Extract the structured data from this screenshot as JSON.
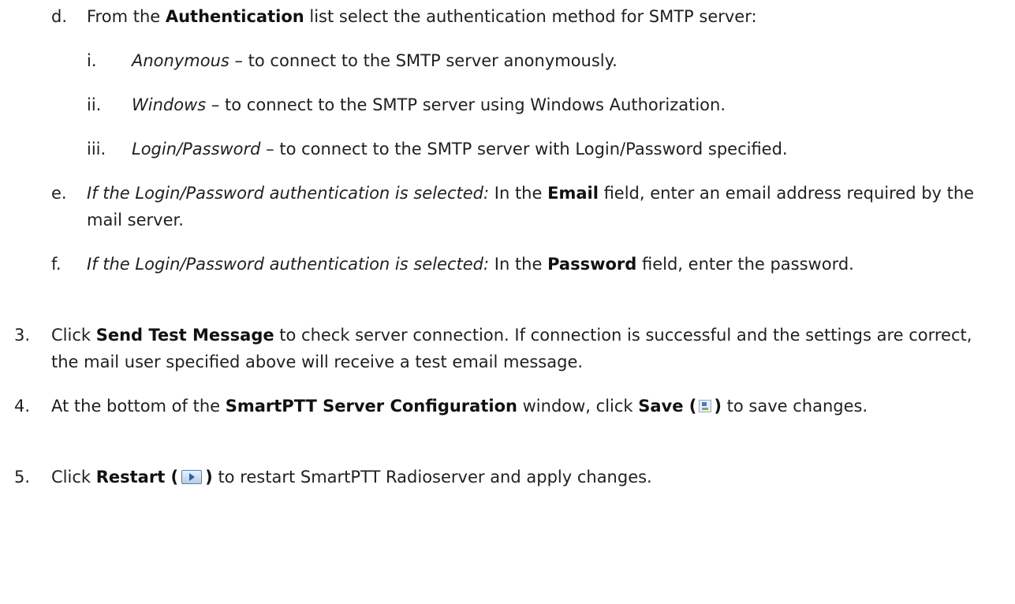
{
  "steps": {
    "d": {
      "marker": "d.",
      "t1": "From the ",
      "b1": "Authentication",
      "t2": " list select the authentication method for SMTP server:"
    },
    "i": {
      "marker": "i.",
      "em": "Anonymous",
      "t1": " – to connect to the SMTP server anonymously."
    },
    "ii": {
      "marker": "ii.",
      "em": "Windows",
      "t1": " – to connect to the SMTP server using Windows Authorization."
    },
    "iii": {
      "marker": "iii.",
      "em": "Login/Password",
      "t1": " – to connect to the SMTP server with Login/Password specified."
    },
    "e": {
      "marker": "e.",
      "em": "If the Login/Password authentication is selected:",
      "t1": " In the ",
      "b1": "Email",
      "t2": " field, enter an email address required by the mail server."
    },
    "f": {
      "marker": "f.",
      "em": "If the Login/Password authentication is selected:",
      "t1": " In the ",
      "b1": "Password",
      "t2": " field, enter the password."
    },
    "s3": {
      "marker": "3.",
      "t1": "Click ",
      "b1": "Send Test Message",
      "t2": " to check server connection. If connection is successful and the settings are correct, the mail user specified above will receive a test email message."
    },
    "s4": {
      "marker": "4.",
      "t1": "At the bottom of the ",
      "b1": "SmartPTT Server Configuration",
      "t2": " window, click ",
      "b2a": "Save (",
      "b2b": ")",
      "t3": " to save changes.",
      "icon": "save-icon"
    },
    "s5": {
      "marker": "5.",
      "t1": "Click ",
      "b1a": "Restart (",
      "b1b": ")",
      "t2": " to restart SmartPTT Radioserver and apply changes.",
      "icon": "restart-icon"
    }
  }
}
